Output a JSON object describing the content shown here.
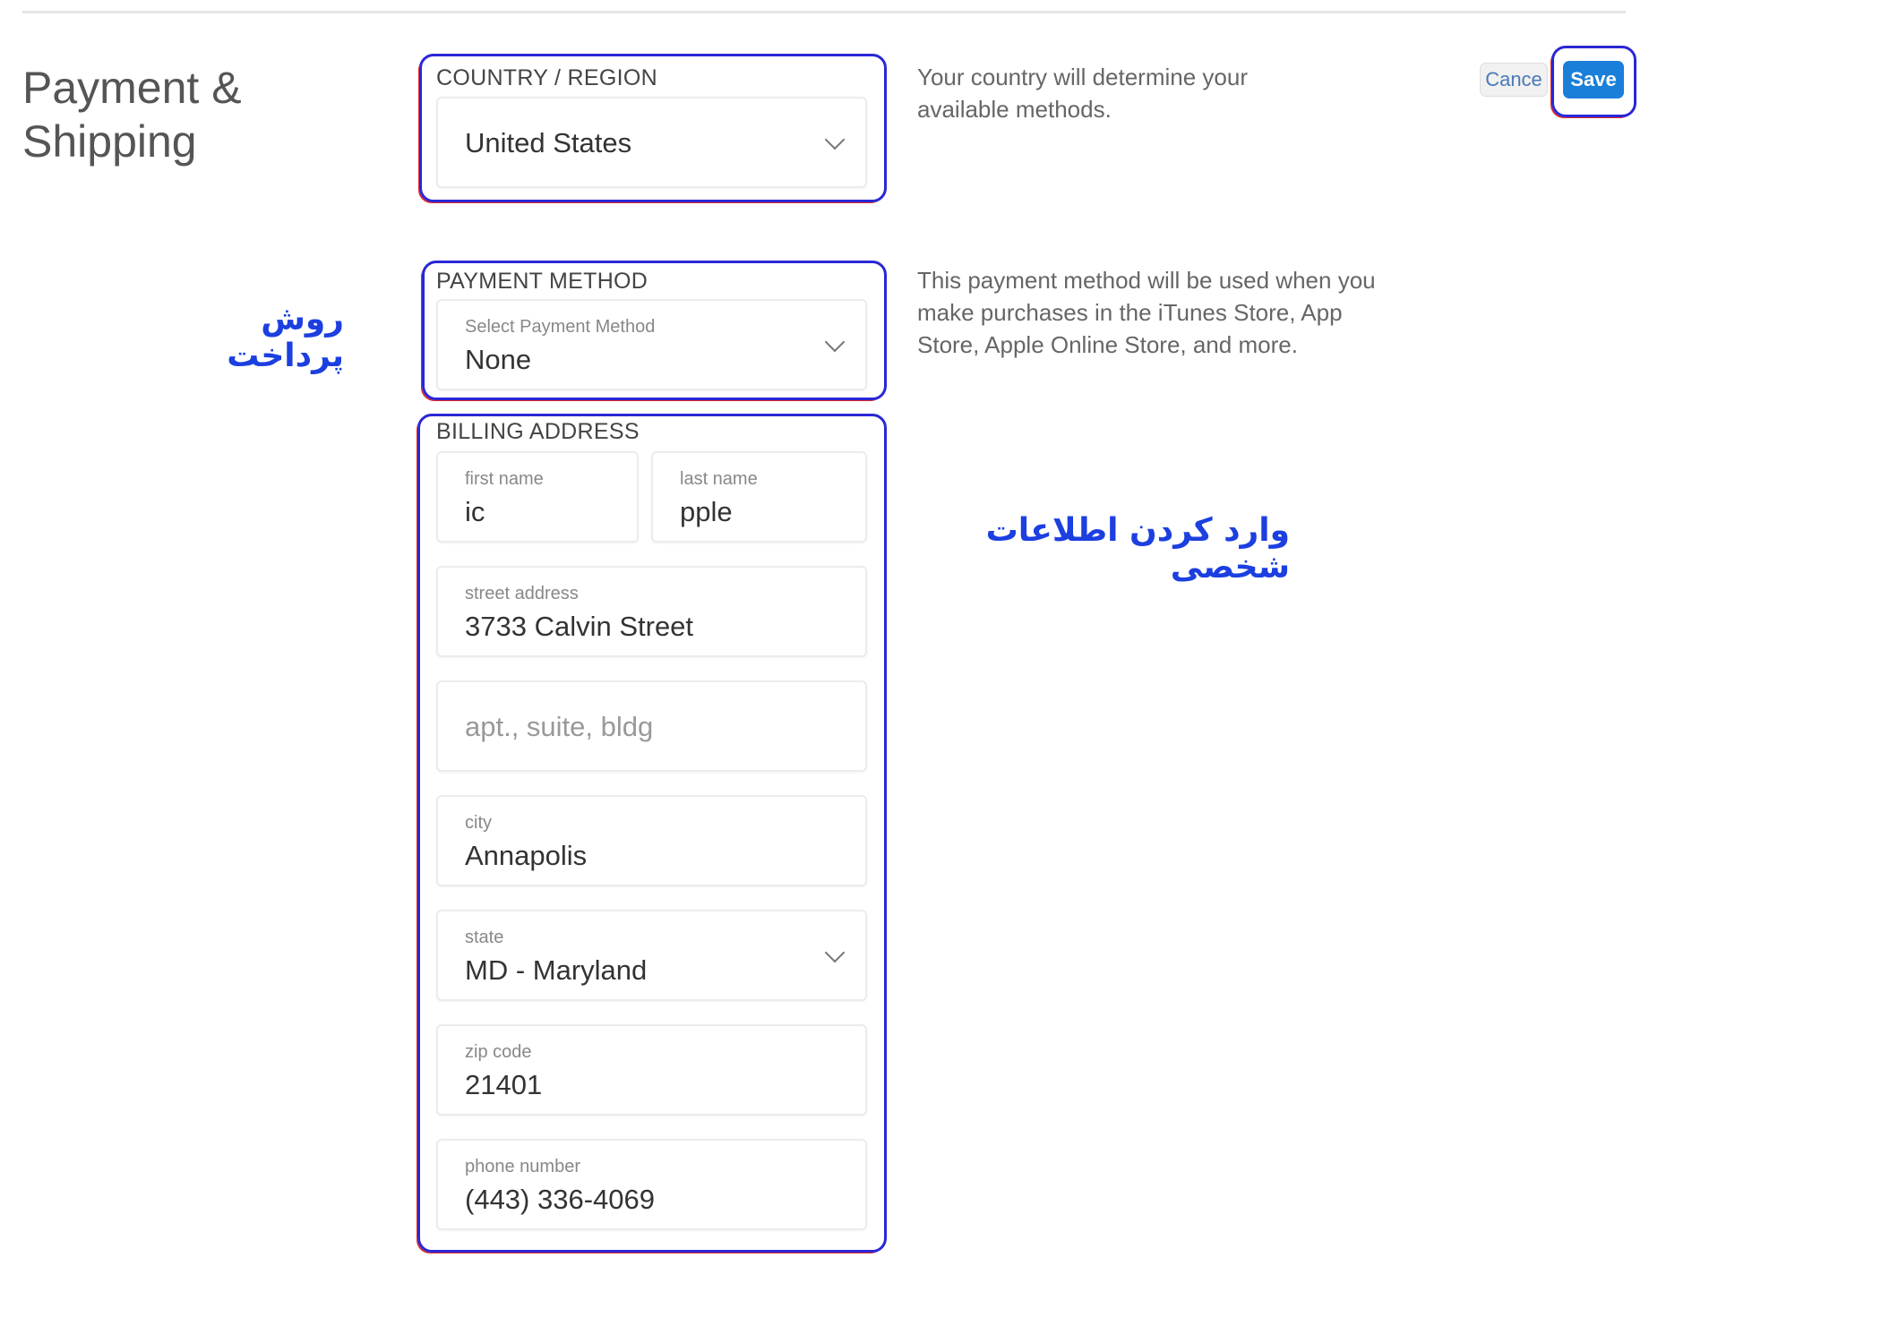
{
  "page": {
    "title": "Payment & Shipping"
  },
  "actions": {
    "cancel_label": "Cance",
    "save_label": "Save"
  },
  "country": {
    "section_label": "COUNTRY / REGION",
    "selected": "United States",
    "description": "Your country will determine your available methods."
  },
  "payment": {
    "section_label": "PAYMENT METHOD",
    "field_label": "Select Payment Method",
    "selected": "None",
    "description": "This payment method will be used when you make purchases in the iTunes Store, App Store, Apple Online Store, and more."
  },
  "billing": {
    "section_label": "BILLING ADDRESS",
    "first_name": {
      "label": "first name",
      "value": "ic"
    },
    "last_name": {
      "label": "last name",
      "value": "pple"
    },
    "street": {
      "label": "street address",
      "value": "3733 Calvin Street"
    },
    "apt": {
      "placeholder": "apt., suite, bldg"
    },
    "city": {
      "label": "city",
      "value": "Annapolis"
    },
    "state": {
      "label": "state",
      "value": "MD - Maryland"
    },
    "zip": {
      "label": "zip code",
      "value": "21401"
    },
    "phone": {
      "label": "phone number",
      "value": "(443) 336-4069"
    }
  },
  "annotations": {
    "payment_method_fa": "روش پرداخت",
    "personal_info_fa": "وارد کردن اطلاعات شخصی",
    "highlight_color": "#2a27d6",
    "accent_color": "#e0262a",
    "text_color": "#1c3fe0"
  }
}
